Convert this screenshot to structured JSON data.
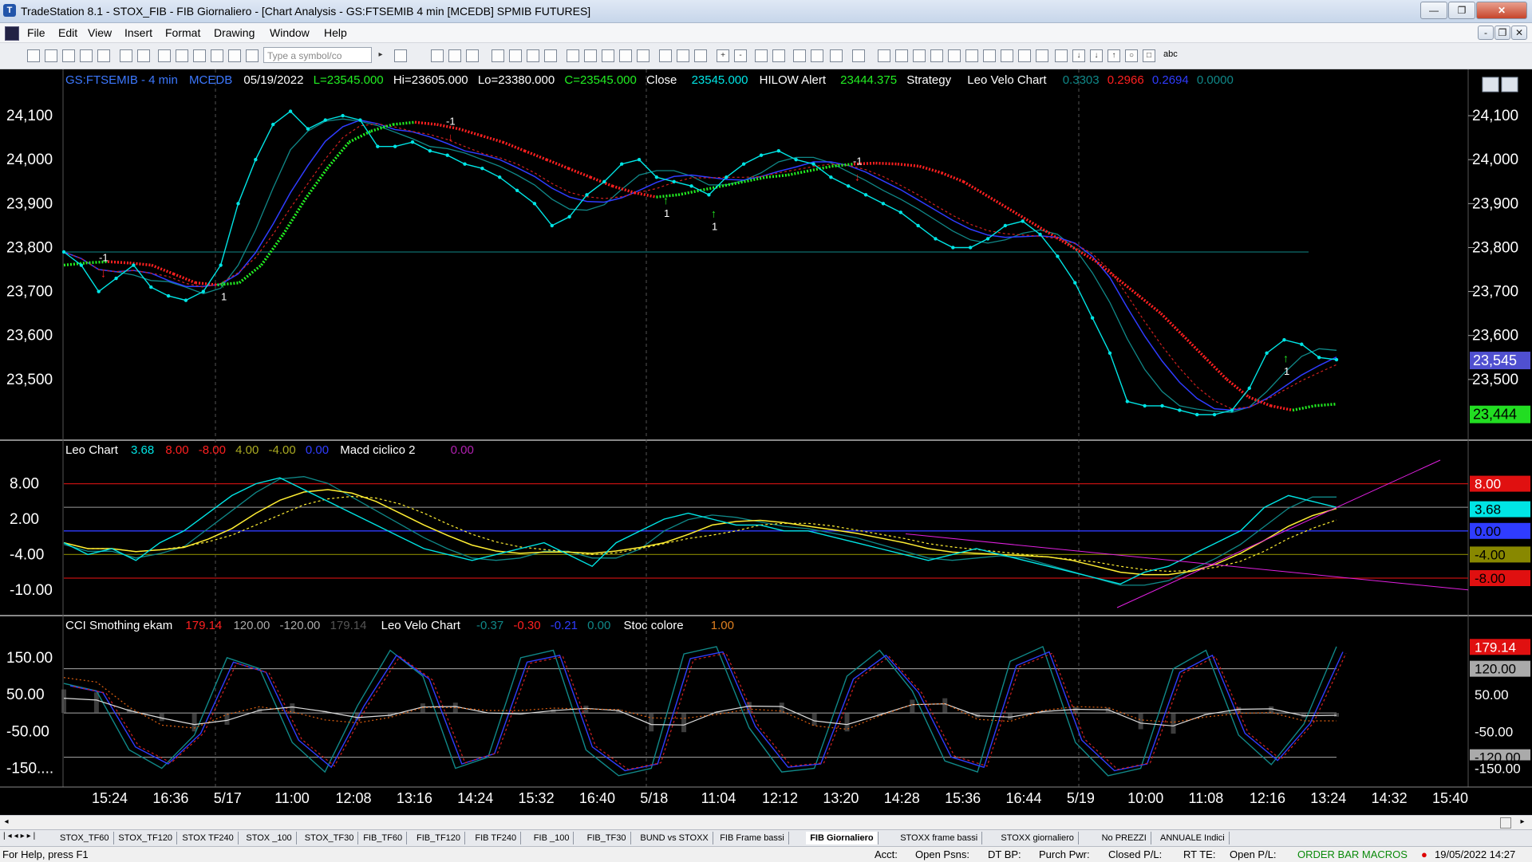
{
  "window": {
    "title": "TradeStation 8.1 - STOX_FIB - FIB Giornaliero - [Chart Analysis - GS:FTSEMIB  4 min  [MCEDB] SPMIB FUTURES]"
  },
  "menu": [
    "File",
    "Edit",
    "View",
    "Insert",
    "Format",
    "Drawing",
    "Window",
    "Help"
  ],
  "toolbar": {
    "symbol_placeholder": "Type a symbol/co",
    "abc": "abc"
  },
  "header": {
    "symbol": "GS:FTSEMIB - 4 min",
    "source": "MCEDB",
    "date": "05/19/2022",
    "last": "L=23545.000",
    "high": "Hi=23605.000",
    "low": "Lo=23380.000",
    "close_eq": "C=23545.000",
    "close_label": "Close",
    "close_value": "23545.000",
    "hilow_label": "HILOW Alert",
    "hilow_value": "23444.375",
    "strategy_label": "Strategy",
    "leo_velo_label": "Leo Velo Chart",
    "v1": "0.3303",
    "v2": "0.2966",
    "v3": "0.2694",
    "v4": "0.0000"
  },
  "pane2_header": {
    "name": "Leo Chart",
    "v1": "3.68",
    "v2": "8.00",
    "v3": "-8.00",
    "v4": "4.00",
    "v5": "-4.00",
    "v6": "0.00",
    "macd_label": "Macd ciclico 2",
    "macd_value": "0.00"
  },
  "pane3_header": {
    "name": "CCI Smothing ekam",
    "v1": "179.14",
    "v2": "120.00",
    "v3": "-120.00",
    "v4": "179.14",
    "leo_label": "Leo Velo Chart",
    "l1": "-0.37",
    "l2": "-0.30",
    "l3": "-0.21",
    "l4": "0.00",
    "stoc_label": "Stoc colore",
    "stoc_value": "1.00"
  },
  "colors": {
    "bg": "#000000",
    "price": "#00e5e5",
    "stop_red": "#ff2020",
    "stop_green": "#22ee22",
    "blue": "#2f3cff",
    "yellow": "#ffee33",
    "magenta": "#e020e0",
    "teal": "#108888",
    "gridline": "#c01010"
  },
  "chart_data": [
    {
      "type": "line",
      "title": "GS:FTSEMIB - 4 min",
      "ylim": [
        23380,
        24160
      ],
      "yticks": [
        "24,100",
        "24,000",
        "23,900",
        "23,800",
        "23,700",
        "23,600",
        "23,500"
      ],
      "ytick_values": [
        24100,
        24000,
        23900,
        23800,
        23700,
        23600,
        23500
      ],
      "badges": {
        "last": "23,545",
        "hilow": "23,444"
      },
      "markers": [
        "-1",
        "1",
        "-1",
        "1",
        "-1",
        "1",
        "1"
      ],
      "series": [
        {
          "name": "Close",
          "values": [
            23790,
            23760,
            23700,
            23730,
            23760,
            23710,
            23690,
            23680,
            23700,
            23760,
            23900,
            24000,
            24080,
            24110,
            24070,
            24090,
            24100,
            24090,
            24030,
            24030,
            24040,
            24020,
            24010,
            23990,
            23980,
            23960,
            23930,
            23900,
            23850,
            23870,
            23920,
            23950,
            23990,
            24000,
            23960,
            23950,
            23940,
            23920,
            23960,
            23990,
            24010,
            24020,
            24000,
            23990,
            23960,
            23940,
            23920,
            23900,
            23880,
            23850,
            23820,
            23800,
            23800,
            23820,
            23850,
            23860,
            23830,
            23780,
            23720,
            23640,
            23560,
            23450,
            23440,
            23440,
            23430,
            23420,
            23420,
            23430,
            23480,
            23560,
            23590,
            23580,
            23550,
            23545
          ]
        },
        {
          "name": "HILOW Alert",
          "values": [
            23760,
            23765,
            23768,
            23765,
            23760,
            23740,
            23720,
            23715,
            23720,
            23760,
            23830,
            23910,
            23980,
            24040,
            24065,
            24080,
            24085,
            24080,
            24070,
            24055,
            24040,
            24020,
            24000,
            23980,
            23960,
            23940,
            23925,
            23915,
            23920,
            23930,
            23940,
            23950,
            23960,
            23965,
            23975,
            23985,
            23990,
            23992,
            23990,
            23985,
            23970,
            23950,
            23920,
            23890,
            23860,
            23830,
            23800,
            23770,
            23730,
            23690,
            23650,
            23600,
            23550,
            23500,
            23460,
            23440,
            23430,
            23440,
            23444
          ]
        }
      ]
    },
    {
      "type": "line",
      "title": "Leo Chart",
      "ylim": [
        -13,
        12
      ],
      "yticks": [
        "8.00",
        "2.00",
        "-4.00",
        "-10.00"
      ],
      "ytick_values": [
        8,
        2,
        -4,
        -10
      ],
      "hlines": [
        8,
        4,
        0,
        -4,
        -8
      ],
      "badges": [
        "8.00",
        "3.68",
        "0.00",
        "-4.00",
        "-8.00"
      ],
      "series": [
        {
          "name": "Leo Chart",
          "values": [
            -2,
            -4,
            -3,
            -5,
            -2,
            0,
            3,
            6,
            8,
            9,
            7,
            5,
            3,
            1,
            -1,
            -3,
            -4,
            -5,
            -4,
            -3,
            -2,
            -4,
            -6,
            -2,
            0,
            2,
            3,
            2,
            1,
            1,
            0,
            0,
            -1,
            -2,
            -3,
            -4,
            -5,
            -4,
            -3,
            -4,
            -5,
            -6,
            -7,
            -8,
            -9,
            -7,
            -6,
            -4,
            -2,
            0,
            4,
            6,
            5,
            4
          ]
        }
      ]
    },
    {
      "type": "line",
      "title": "CCI Smothing ekam",
      "ylim": [
        -190,
        210
      ],
      "yticks": [
        "150.00",
        "50.00",
        "-50.00",
        "-150...."
      ],
      "ytick_values": [
        150,
        50,
        -50,
        -150
      ],
      "hlines": [
        120,
        0,
        -120
      ],
      "badges": [
        "179.14",
        "120.00",
        "50.00",
        "-50.00",
        "-120.00",
        "-150.00"
      ],
      "series": [
        {
          "name": "CCI Smothing ekam",
          "values": [
            80,
            60,
            -100,
            -150,
            -60,
            150,
            120,
            -80,
            -160,
            20,
            170,
            100,
            -150,
            -120,
            150,
            170,
            -100,
            -170,
            -150,
            160,
            180,
            -40,
            -160,
            -150,
            100,
            170,
            60,
            -130,
            -160,
            140,
            180,
            -80,
            -170,
            -150,
            120,
            170,
            -60,
            -140,
            -30,
            180
          ]
        }
      ]
    }
  ],
  "time_labels": [
    "15:24",
    "16:36",
    "5/17",
    "11:00",
    "12:08",
    "13:16",
    "14:24",
    "15:32",
    "16:40",
    "5/18",
    "11:04",
    "12:12",
    "13:20",
    "14:28",
    "15:36",
    "16:44",
    "5/19",
    "10:00",
    "11:08",
    "12:16",
    "13:24",
    "14:32",
    "15:40"
  ],
  "tabs": [
    "STOX_TF60",
    "STOX_TF120",
    "STOX TF240",
    "STOX _100",
    "STOX_TF30",
    "FIB_TF60",
    "FIB_TF120",
    "FIB TF240",
    "FIB _100",
    "FIB_TF30",
    "BUND vs STOXX",
    "FIB Frame bassi",
    "FIB Giornaliero",
    "STOXX frame bassi",
    "STOXX giornaliero",
    "No PREZZI",
    "ANNUALE Indici"
  ],
  "active_tab": "FIB Giornaliero",
  "status": {
    "help": "For Help, press F1",
    "acct": "Acct:",
    "open_psns": "Open Psns:",
    "dt_bp": "DT BP:",
    "purch_pwr": "Purch Pwr:",
    "closed_pl": "Closed P/L:",
    "rt_te": "RT TE:",
    "open_pl": "Open P/L:",
    "macros": "ORDER BAR  MACROS",
    "datetime": "19/05/2022 14:27"
  }
}
